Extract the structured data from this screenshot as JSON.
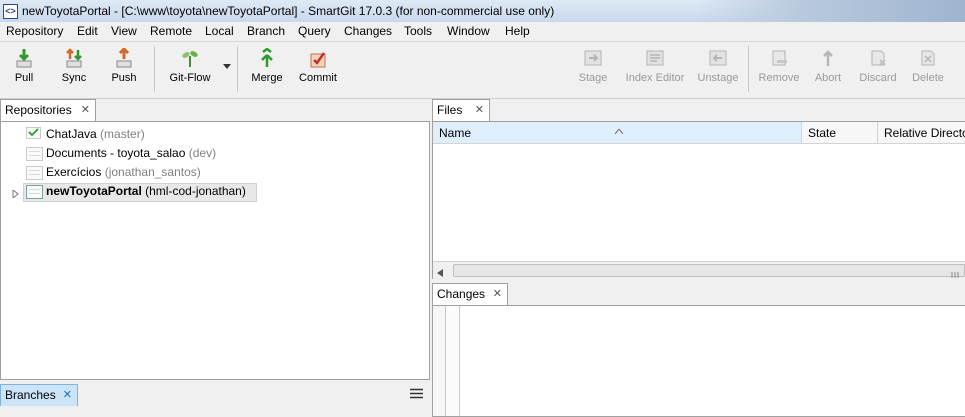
{
  "window": {
    "title": "newToyotaPortal - [C:\\www\\toyota\\newToyotaPortal] - SmartGit 17.0.3 (for non-commercial use only)",
    "app_icon": "<>"
  },
  "menu": [
    "Repository",
    "Edit",
    "View",
    "Remote",
    "Local",
    "Branch",
    "Query",
    "Changes",
    "Tools",
    "Window",
    "Help"
  ],
  "toolbar": {
    "pull": "Pull",
    "sync": "Sync",
    "push": "Push",
    "gitflow": "Git-Flow",
    "merge": "Merge",
    "commit": "Commit",
    "stage": "Stage",
    "index_editor": "Index Editor",
    "unstage": "Unstage",
    "remove": "Remove",
    "abort": "Abort",
    "discard": "Discard",
    "delete": "Delete"
  },
  "repositories": {
    "tab": "Repositories",
    "items": [
      {
        "name": "ChatJava",
        "branch": "(master)",
        "bold": false
      },
      {
        "name": "Documents - toyota_salao",
        "branch": "(dev)",
        "bold": false
      },
      {
        "name": "Exercícios",
        "branch": "(jonathan_santos)",
        "bold": false
      },
      {
        "name": "newToyotaPortal",
        "branch": "(hml-cod-jonathan)",
        "bold": true
      }
    ]
  },
  "branches": {
    "tab": "Branches"
  },
  "files": {
    "tab": "Files",
    "columns": [
      "Name",
      "State",
      "Relative Directory"
    ]
  },
  "changes": {
    "tab": "Changes"
  },
  "colors": {
    "accent": "#3399ff",
    "selected_tab": "#cce4f7",
    "selected_row": "#e8e8e8"
  }
}
